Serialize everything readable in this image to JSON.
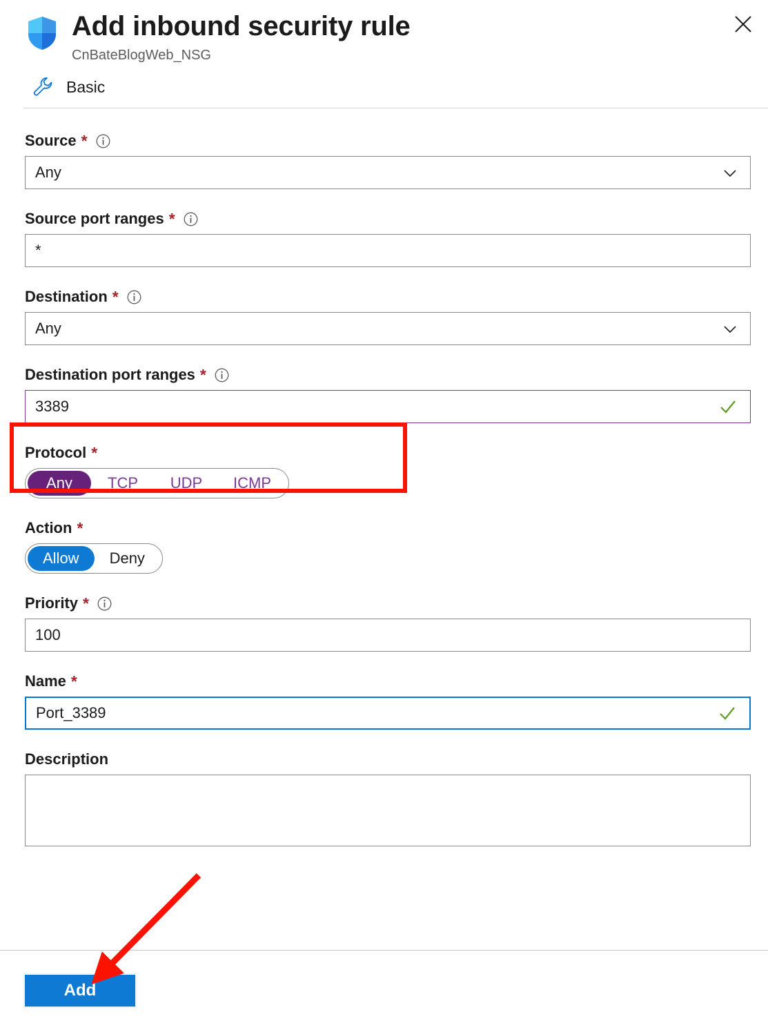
{
  "header": {
    "title": "Add inbound security rule",
    "subtitle": "CnBateBlogWeb_NSG",
    "shield_icon": "shield-icon",
    "close_icon": "close-icon"
  },
  "tab": {
    "icon": "wrench-icon",
    "label": "Basic"
  },
  "fields": {
    "source": {
      "label": "Source",
      "required": "*",
      "info_icon": "info-icon",
      "value": "Any",
      "chevron_icon": "chevron-down-icon"
    },
    "source_port_ranges": {
      "label": "Source port ranges",
      "required": "*",
      "info_icon": "info-icon",
      "value": "*"
    },
    "destination": {
      "label": "Destination",
      "required": "*",
      "info_icon": "info-icon",
      "value": "Any",
      "chevron_icon": "chevron-down-icon"
    },
    "destination_port_ranges": {
      "label": "Destination port ranges",
      "required": "*",
      "info_icon": "info-icon",
      "value": "3389",
      "valid_icon": "checkmark-icon"
    },
    "protocol": {
      "label": "Protocol",
      "required": "*",
      "options": [
        "Any",
        "TCP",
        "UDP",
        "ICMP"
      ],
      "selected": "Any"
    },
    "action": {
      "label": "Action",
      "required": "*",
      "options": [
        "Allow",
        "Deny"
      ],
      "selected": "Allow"
    },
    "priority": {
      "label": "Priority",
      "required": "*",
      "info_icon": "info-icon",
      "value": "100"
    },
    "name": {
      "label": "Name",
      "required": "*",
      "value": "Port_3389",
      "valid_icon": "checkmark-icon"
    },
    "description": {
      "label": "Description",
      "value": ""
    }
  },
  "footer": {
    "add_label": "Add"
  },
  "colors": {
    "accent_blue": "#0f7ad4",
    "purple": "#68217a",
    "purple_text": "#7a3a96",
    "required_red": "#a4262c",
    "valid_green": "#5d9b1f",
    "annotation_red": "#fb1200",
    "border_gray": "#8a8886"
  }
}
